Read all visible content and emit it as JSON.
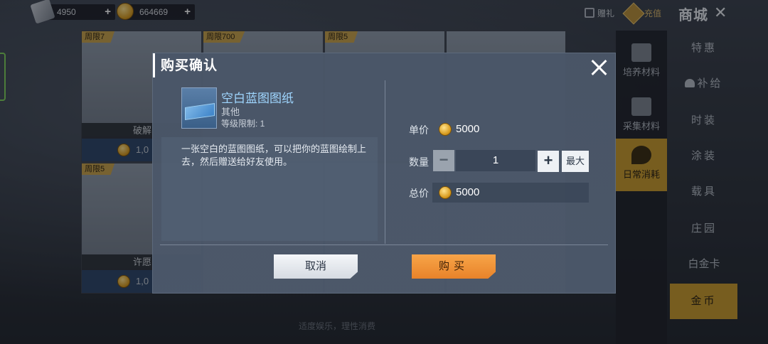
{
  "currency": {
    "tickets": "4950",
    "coins": "664669",
    "plus": "+"
  },
  "header": {
    "gift_label": "赠礼",
    "recharge_label": "充值",
    "title": "商城"
  },
  "cards": [
    {
      "limit": "周限7",
      "name": "破解",
      "price": "1,0"
    },
    {
      "limit": "周限700",
      "name": "",
      "price": ""
    },
    {
      "limit": "周限5",
      "name": "",
      "price": ""
    },
    {
      "limit": "周限5",
      "name": "许愿",
      "price": "1,0"
    }
  ],
  "categories": [
    {
      "label": "培养材料"
    },
    {
      "label": "采集材料"
    },
    {
      "label": "日常消耗",
      "active": true
    }
  ],
  "nav": [
    {
      "label": "特惠"
    },
    {
      "label": "补给"
    },
    {
      "label": "时装"
    },
    {
      "label": "涂装"
    },
    {
      "label": "载具"
    },
    {
      "label": "庄园"
    },
    {
      "label": "白金卡"
    },
    {
      "label": "金币",
      "active": true
    }
  ],
  "slogan": "适度娱乐，理性消费",
  "dialog": {
    "title": "购买确认",
    "item": {
      "name": "空白蓝图图纸",
      "type": "其他",
      "level": "等级限制: 1",
      "description": "一张空白的蓝图图纸，可以把你的蓝图绘制上去，然后赠送给好友使用。"
    },
    "unit_price_label": "单价",
    "unit_price": "5000",
    "quantity_label": "数量",
    "quantity": "1",
    "minus": "−",
    "plus": "+",
    "max_label": "最大",
    "total_label": "总价",
    "total_price": "5000",
    "cancel_label": "取消",
    "buy_label": "购买"
  },
  "colors": {
    "accent_orange": "#e8832a",
    "active_gold": "#c89a2c",
    "item_name_blue": "#9fd6ff"
  }
}
